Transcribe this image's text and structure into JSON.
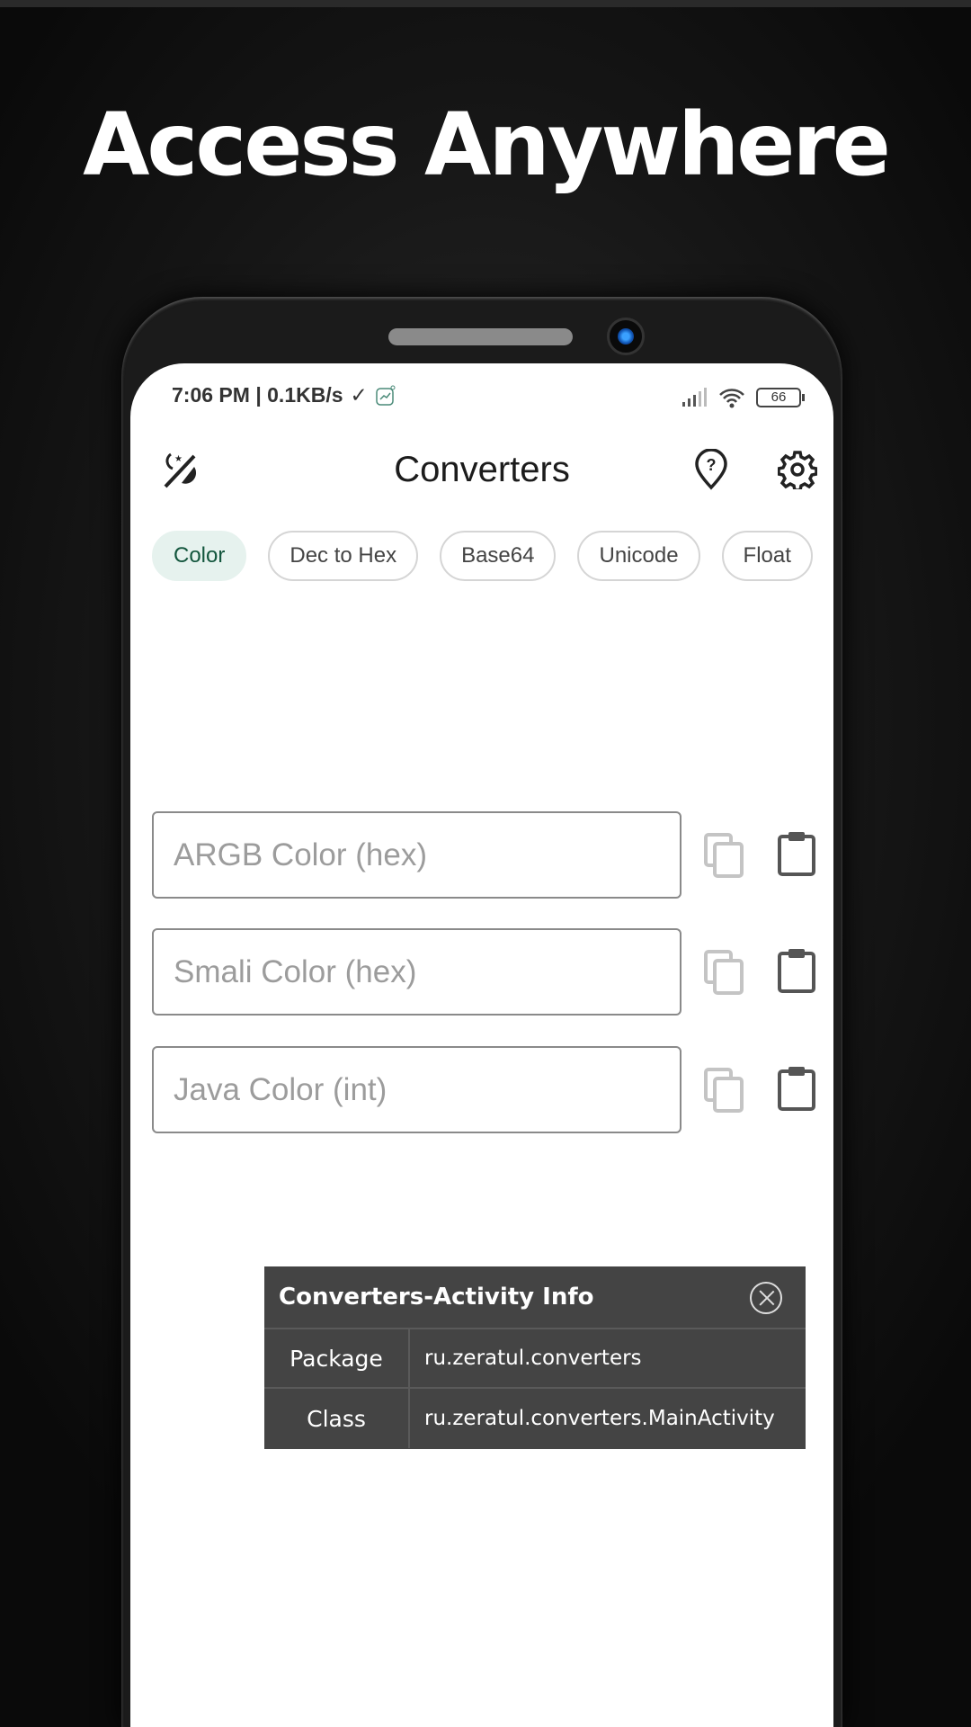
{
  "promo": {
    "headline": "Access Anywhere"
  },
  "status_bar": {
    "time_speed": "7:06 PM | 0.1KB/s",
    "check": "✓",
    "battery": "66"
  },
  "app_bar": {
    "title": "Converters"
  },
  "chips": [
    {
      "label": "Color",
      "active": true
    },
    {
      "label": "Dec to Hex"
    },
    {
      "label": "Base64"
    },
    {
      "label": "Unicode"
    },
    {
      "label": "Float"
    }
  ],
  "fields": [
    {
      "placeholder": "ARGB Color (hex)",
      "value": ""
    },
    {
      "placeholder": "Smali Color (hex)",
      "value": ""
    },
    {
      "placeholder": "Java Color (int)",
      "value": ""
    }
  ],
  "popup": {
    "title": "Converters-Activity Info",
    "rows": [
      {
        "key": "Package",
        "value": "ru.zeratul.converters"
      },
      {
        "key": "Class",
        "value": "ru.zeratul.converters.MainActivity"
      }
    ]
  },
  "colors": {
    "accent_chip_bg": "#e6f2ee",
    "accent_chip_text": "#13563d",
    "popup_bg": "#444444"
  }
}
